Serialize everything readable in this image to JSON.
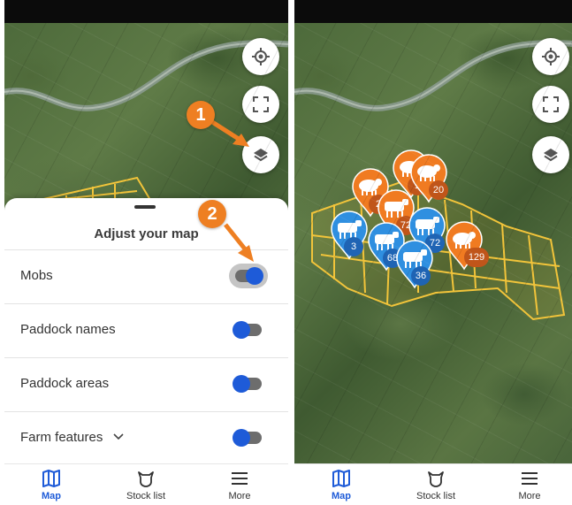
{
  "left_screen": {
    "sheet": {
      "title": "Adjust your map",
      "rows": [
        {
          "label": "Mobs",
          "enabled": true
        },
        {
          "label": "Paddock names",
          "enabled": true
        },
        {
          "label": "Paddock areas",
          "enabled": true
        },
        {
          "label": "Farm features",
          "enabled": true,
          "expandable": true
        }
      ]
    },
    "map_buttons": [
      "locate-icon",
      "fullscreen-icon",
      "layers-icon"
    ],
    "callouts": [
      "1",
      "2"
    ]
  },
  "right_screen": {
    "map_buttons": [
      "locate-icon",
      "fullscreen-icon",
      "layers-icon"
    ],
    "mob_pins": [
      {
        "color": "orange",
        "animal": "sheep",
        "count": "1"
      },
      {
        "color": "orange",
        "animal": "sheep",
        "count": "20"
      },
      {
        "color": "orange",
        "animal": "sheep",
        "count": "2"
      },
      {
        "color": "orange",
        "animal": "cattle",
        "count": "72"
      },
      {
        "color": "blue",
        "animal": "cattle",
        "count": "3"
      },
      {
        "color": "blue",
        "animal": "cattle",
        "count": "68"
      },
      {
        "color": "blue",
        "animal": "cattle",
        "count": "72"
      },
      {
        "color": "blue",
        "animal": "cattle",
        "count": "36"
      },
      {
        "color": "orange",
        "animal": "sheep",
        "count": "129"
      }
    ]
  },
  "navbar": {
    "items": [
      {
        "label": "Map",
        "icon": "map-icon",
        "active": true
      },
      {
        "label": "Stock list",
        "icon": "cow-icon",
        "active": false
      },
      {
        "label": "More",
        "icon": "menu-icon",
        "active": false
      }
    ]
  },
  "colors": {
    "accent_blue": "#1e5bd8",
    "callout_orange": "#ee7f22",
    "pin_orange": "#f07b21",
    "pin_blue": "#2f8fe0",
    "paddock_yellow": "#f2c43a"
  }
}
